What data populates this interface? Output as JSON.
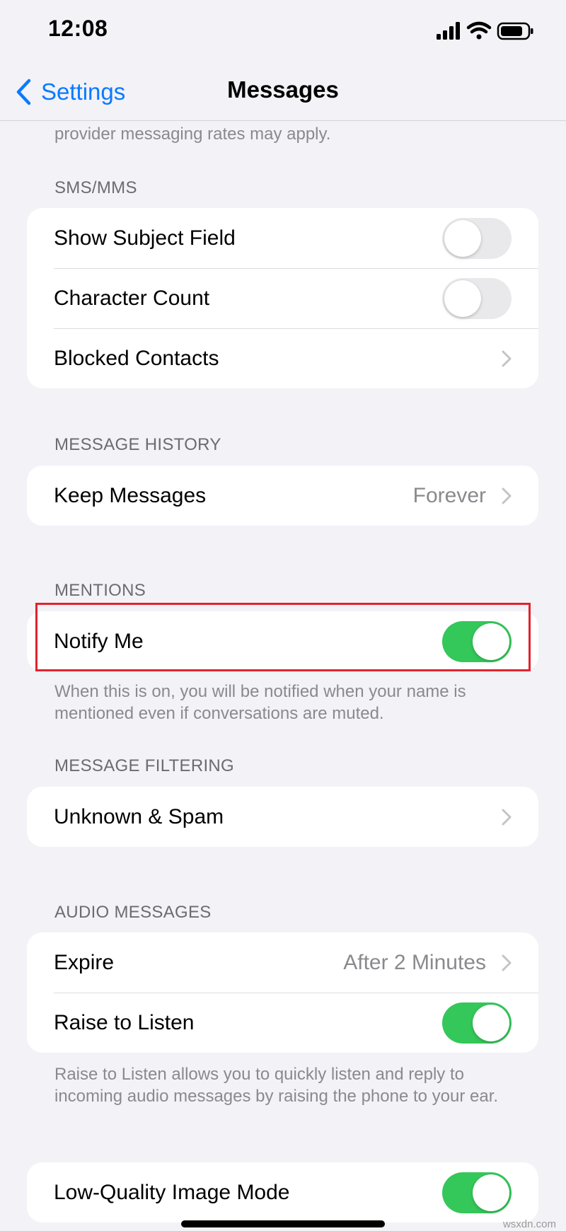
{
  "status_bar": {
    "time": "12:08",
    "signal_icon": "cellular-signal-icon",
    "wifi_icon": "wifi-icon",
    "battery_icon": "battery-icon"
  },
  "nav": {
    "back_label": "Settings",
    "back_icon": "chevron-left-icon",
    "title": "Messages"
  },
  "top_footer": "provider messaging rates may apply.",
  "sms_mms": {
    "header": "SMS/MMS",
    "rows": [
      {
        "label": "Show Subject Field",
        "toggle": false
      },
      {
        "label": "Character Count",
        "toggle": false
      },
      {
        "label": "Blocked Contacts"
      }
    ]
  },
  "message_history": {
    "header": "MESSAGE HISTORY",
    "rows": [
      {
        "label": "Keep Messages",
        "value": "Forever"
      }
    ]
  },
  "mentions": {
    "header": "MENTIONS",
    "rows": [
      {
        "label": "Notify Me",
        "toggle": true
      }
    ],
    "footer": "When this is on, you will be notified when your name is mentioned even if conversations are muted."
  },
  "message_filtering": {
    "header": "MESSAGE FILTERING",
    "rows": [
      {
        "label": "Unknown & Spam"
      }
    ]
  },
  "audio_messages": {
    "header": "AUDIO MESSAGES",
    "rows": [
      {
        "label": "Expire",
        "value": "After 2 Minutes"
      },
      {
        "label": "Raise to Listen",
        "toggle": true
      }
    ],
    "footer": "Raise to Listen allows you to quickly listen and reply to incoming audio messages by raising the phone to your ear."
  },
  "image_mode": {
    "rows": [
      {
        "label": "Low-Quality Image Mode",
        "toggle": true
      }
    ]
  },
  "watermark": "wsxdn.com",
  "colors": {
    "accent": "#0a7aff",
    "toggle_on": "#34c759",
    "highlight": "#e0232e",
    "background": "#f2f2f7"
  }
}
